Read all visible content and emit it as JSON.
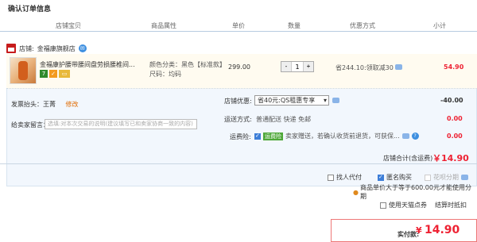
{
  "page_title": "确认订单信息",
  "columns": [
    "店铺宝贝",
    "商品属性",
    "单价",
    "数量",
    "优惠方式",
    "小计"
  ],
  "shop": {
    "label": "店铺:",
    "name": "金福康旗舰店"
  },
  "item": {
    "name": "金福康护腰带腰间盘劳损腰椎间...",
    "attr_color": "颜色分类：黑色【标准款】",
    "attr_size": "尺码：均码",
    "price": "299.00",
    "qty_minus": "-",
    "qty": "1",
    "qty_plus": "+",
    "discount": "省244.10:领取减30",
    "subtotal": "54.90",
    "icon_badges": [
      "7",
      "✓"
    ]
  },
  "invoice": {
    "label": "发票抬头：王菁",
    "edit": "修改"
  },
  "message": {
    "label": "给卖家留言：",
    "placeholder": "选填:对本次交易的说明(建议填写已和卖家协商一致的内容)"
  },
  "shop_coupon": {
    "label": "店铺优惠:",
    "selected": "省40元:QS租惠专享",
    "value": "-40.00"
  },
  "shipping": {
    "label": "运送方式:",
    "value": "普通配送 快递 免邮",
    "amount": "0.00"
  },
  "insurance": {
    "label": "运费险:",
    "tag": "运费险",
    "text": "卖家赠送，若确认收货前退货，可获保...",
    "amount": "0.00"
  },
  "shop_total": {
    "label": "店铺合计(含运费)",
    "amount": "￥14.90"
  },
  "options": {
    "proxy_pay": "找人代付",
    "anonymous": "匿名购买",
    "huabei": "花呗分期",
    "huabei_note": "商品单价大于等于600.00元才能使用分期",
    "tmall_points": "使用天猫点券",
    "settle": "结算时抵扣"
  },
  "final": {
    "label": "实付款:",
    "currency": "¥",
    "amount": "14.90"
  }
}
